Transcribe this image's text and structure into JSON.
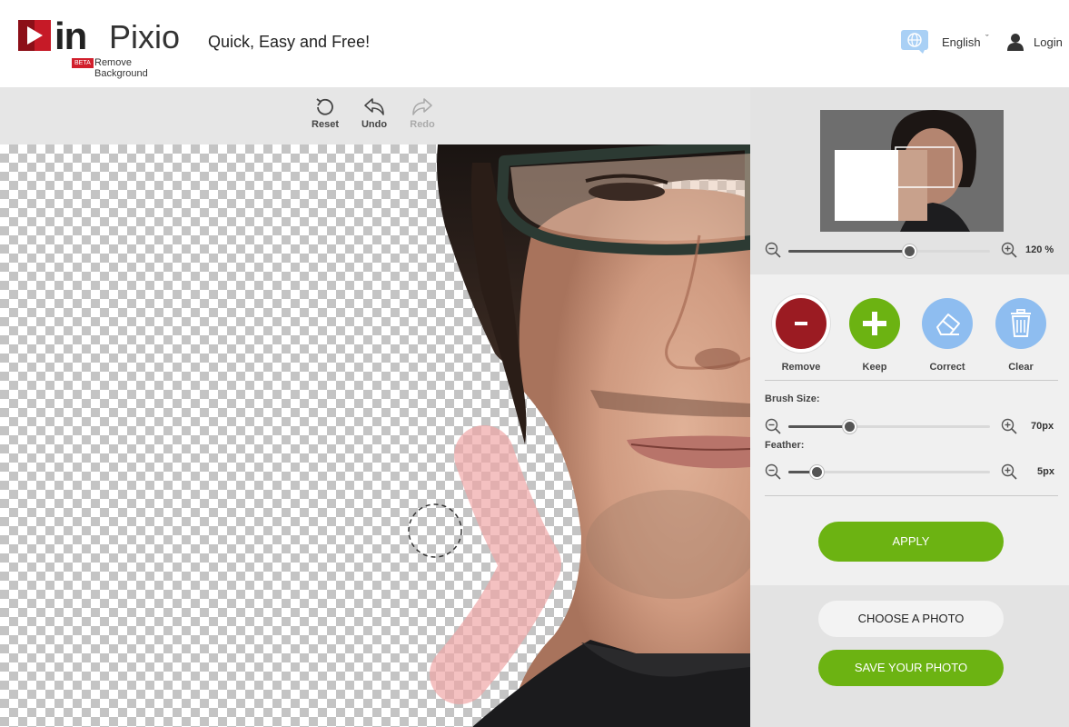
{
  "header": {
    "logo_in": "in",
    "logo_pixio": "Pixio",
    "logo_beta": "BETA",
    "logo_sub": "Remove Background",
    "tagline": "Quick, Easy and Free!",
    "language": "English",
    "login": "Login"
  },
  "toolbar": {
    "reset": "Reset",
    "undo": "Undo",
    "redo": "Redo"
  },
  "panel": {
    "zoom_value": "120 %",
    "zoom_level": 0.6,
    "modes": {
      "remove": "Remove",
      "keep": "Keep",
      "correct": "Correct",
      "clear": "Clear"
    },
    "brush_label": "Brush Size:",
    "brush_value": "70px",
    "brush_level": 0.3,
    "feather_label": "Feather:",
    "feather_value": "5px",
    "feather_level": 0.14,
    "apply": "APPLY",
    "choose": "CHOOSE A PHOTO",
    "save": "SAVE YOUR PHOTO"
  },
  "colors": {
    "accent_green": "#6cb312",
    "remove_red": "#9b1b22",
    "light_blue": "#8ebdf0",
    "brand_red": "#d11f2c"
  }
}
